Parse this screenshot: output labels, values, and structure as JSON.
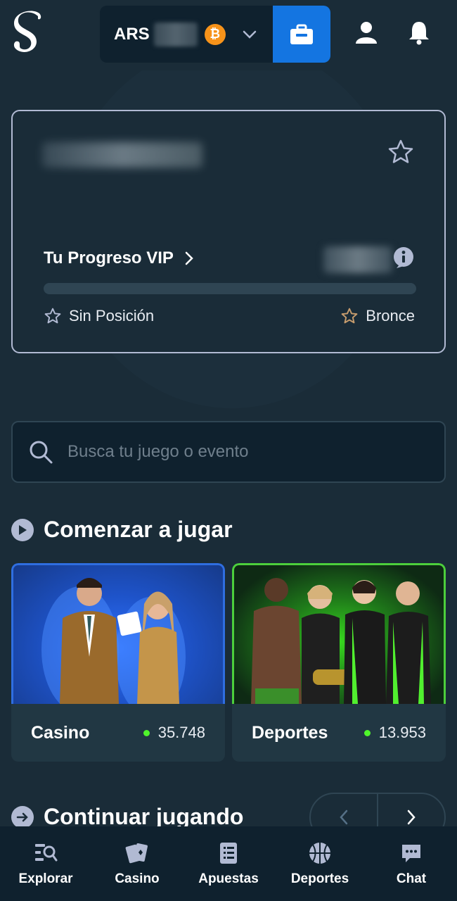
{
  "header": {
    "currency": "ARS",
    "coin": "₿"
  },
  "vip": {
    "progress_label": "Tu Progreso VIP",
    "rank_current": "Sin Posición",
    "rank_next": "Bronce",
    "progress_percent": 0
  },
  "search": {
    "placeholder": "Busca tu juego o evento"
  },
  "sections": {
    "start": "Comenzar a jugar",
    "continue": "Continuar jugando"
  },
  "tiles": [
    {
      "name": "Casino",
      "count": "35.748"
    },
    {
      "name": "Deportes",
      "count": "13.953"
    }
  ],
  "nav": [
    {
      "label": "Explorar",
      "icon": "explore-icon"
    },
    {
      "label": "Casino",
      "icon": "cards-icon"
    },
    {
      "label": "Apuestas",
      "icon": "bet-slip-icon"
    },
    {
      "label": "Deportes",
      "icon": "basketball-icon"
    },
    {
      "label": "Chat",
      "icon": "chat-icon"
    }
  ],
  "colors": {
    "background": "#1a2c38",
    "panel": "#0f212e",
    "accent_blue": "#1475e1",
    "online_green": "#4ff52b",
    "bitcoin": "#f7931a"
  }
}
